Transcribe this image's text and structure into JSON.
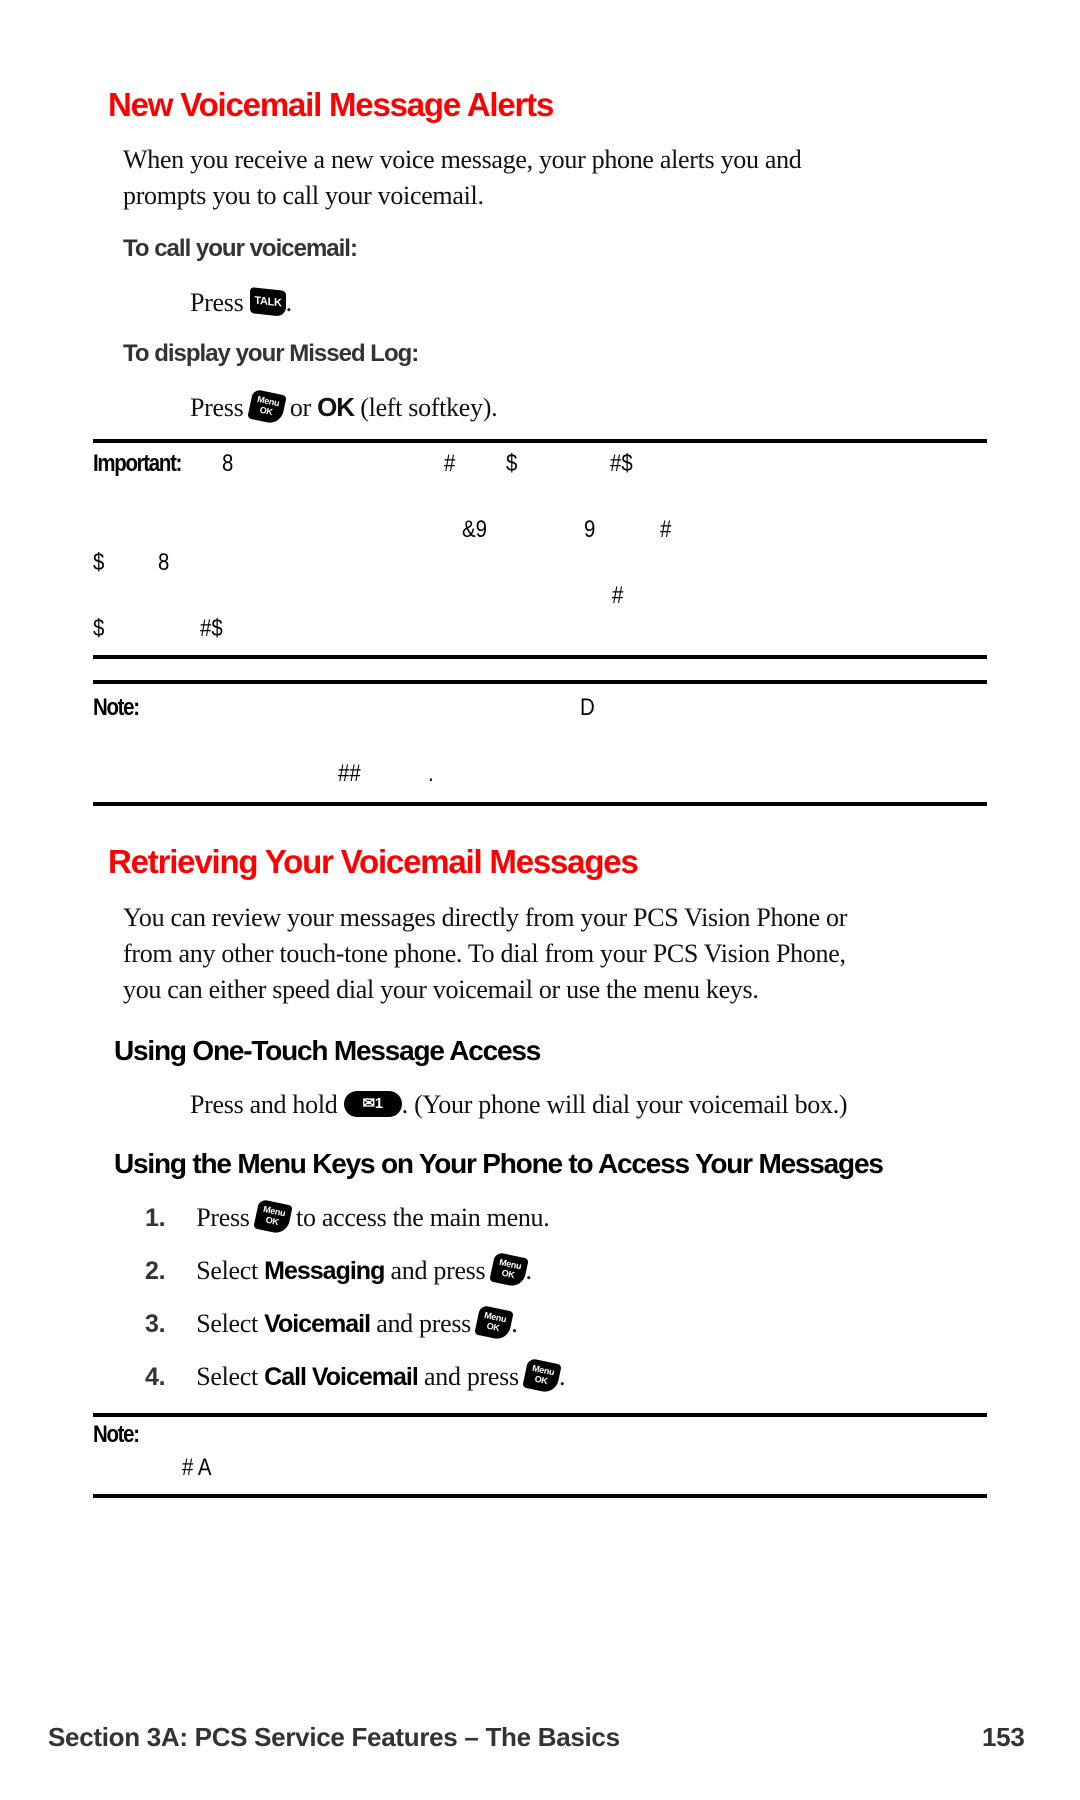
{
  "section1": {
    "heading": "New Voicemail Message Alerts",
    "intro_line1": "When you receive a new voice message, your phone alerts you and",
    "intro_line2": "prompts you to call your voicemail.",
    "call_label": "To call your voicemail:",
    "call_press": "Press",
    "call_key": "TALK",
    "call_end": ".",
    "missed_label": "To display your Missed Log:",
    "missed_press": "Press",
    "menu_key_top": "Menu",
    "menu_key_bottom": "OK",
    "missed_or": "or",
    "missed_ok": "OK",
    "missed_end": "(left softkey)."
  },
  "important_box": {
    "label": "Important:",
    "garbled_lines": [
      [
        "8",
        "#",
        "$",
        "#$"
      ],
      [],
      [
        "&9",
        "9",
        "#"
      ],
      [
        "$",
        "8"
      ],
      [
        "#"
      ],
      [
        "$",
        "#$"
      ]
    ]
  },
  "note_box1": {
    "label": "Note:",
    "garbled_line1": "D",
    "garbled_line2a": "##",
    "garbled_line2b": "."
  },
  "section2": {
    "heading": "Retrieving Your Voicemail Messages",
    "intro_line1": "You can review your messages directly from your PCS Vision Phone or",
    "intro_line2": "from any other touch-tone phone. To dial from your PCS Vision Phone,",
    "intro_line3": "you can either speed dial your voicemail or use the menu keys.",
    "onetouch_heading": "Using One-Touch Message Access",
    "onetouch_text_a": "Press and hold",
    "onetouch_key": "1",
    "onetouch_text_b": ". (Your phone will dial your voicemail box.)",
    "menukeys_heading": "Using the Menu Keys on Your Phone to Access Your Messages",
    "steps": [
      {
        "num": "1.",
        "pre": "Press",
        "bold": "",
        "post": "to access the main menu.",
        "end": ""
      },
      {
        "num": "2.",
        "pre": "Select",
        "bold": "Messaging",
        "post": "and press",
        "end": "."
      },
      {
        "num": "3.",
        "pre": "Select",
        "bold": "Voicemail",
        "post": "and press",
        "end": "."
      },
      {
        "num": "4.",
        "pre": "Select",
        "bold": "Call Voicemail",
        "post": "and press",
        "end": "."
      }
    ]
  },
  "note_box2": {
    "label": "Note:",
    "garbled_line": "# A"
  },
  "footer": {
    "section_title": "Section 3A: PCS Service Features – The Basics",
    "page_number": "153"
  },
  "colors": {
    "heading_red": "#ff0000"
  }
}
